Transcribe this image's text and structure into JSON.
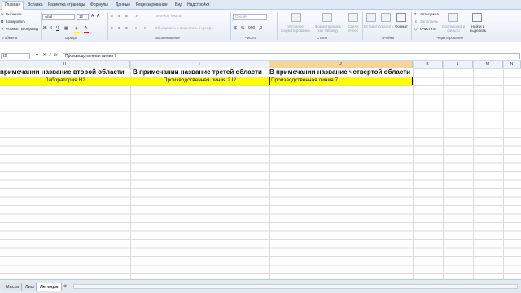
{
  "ribbon_tabs": [
    "Главная",
    "Вставка",
    "Разметка страницы",
    "Формулы",
    "Данные",
    "Рецензирование",
    "Вид",
    "Надстройки"
  ],
  "clipboard": {
    "cut": "Вырезать",
    "copy": "Копировать",
    "format_painter": "Формат по образцу",
    "group": "р обмена"
  },
  "font": {
    "name": "Arial",
    "size": "12",
    "group": "Шрифт"
  },
  "alignment": {
    "wrap": "Перенос текста",
    "merge": "Объединить и поместить в центре",
    "group": "Выравнивание"
  },
  "number": {
    "format": "Общий",
    "group": "Число"
  },
  "styles": {
    "conditional": "Условное форматирование",
    "as_table": "Форматировать как таблицу",
    "cell_styles": "Стили ячеек",
    "group": "Стили"
  },
  "cells": {
    "insert": "Вставить",
    "delete": "Удалить",
    "format": "Формат",
    "group": "Ячейки"
  },
  "editing": {
    "autosum": "Автосумма",
    "fill": "Заполнить",
    "clear": "Очистить",
    "sort": "Сортировка и фильтр",
    "find": "Найти и выделить",
    "group": "Редактирование"
  },
  "formula_bar": {
    "name_box": "I2",
    "value": "Производственная линия 7",
    "fx": "fx"
  },
  "columns": [
    "H",
    "I",
    "J",
    "K",
    "L",
    "M",
    "N"
  ],
  "header_row": {
    "h": "примечании название второй области",
    "i": "В примечании название третей области",
    "j": "В примечании название четвертой области"
  },
  "data_row": {
    "h": "Лаборатория Н2",
    "i": "Производственная линия 2 I2",
    "j": "Производственная линия 7"
  },
  "sheets": [
    "Маска",
    "Лист",
    "Легенда"
  ],
  "colors": {
    "highlight": "#ffff00",
    "selected_column": "#f8d68f"
  }
}
